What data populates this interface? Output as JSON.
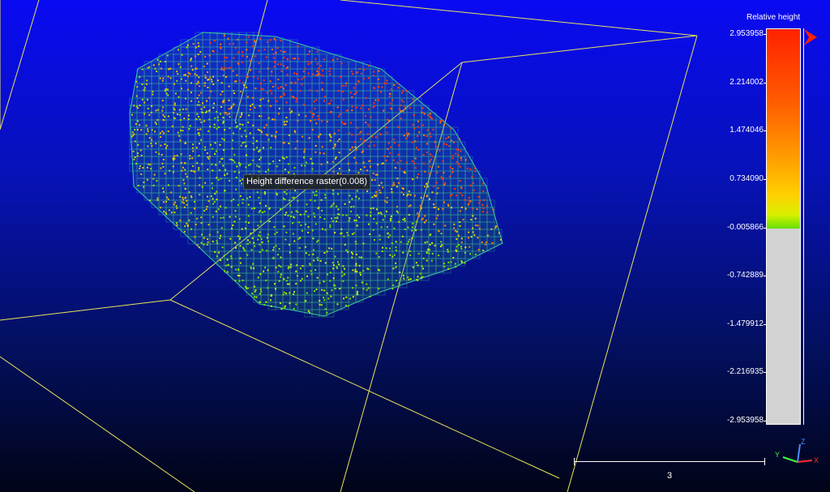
{
  "viewer": {
    "object_label": "Height difference raster(0.008)",
    "background_top": "#0a0af2",
    "background_bottom": "#010417",
    "bbox_color": "#e6e65a"
  },
  "legend": {
    "title": "Relative height",
    "ticks": [
      "2.953958",
      "2.214002",
      "1.474046",
      "0.734090",
      "-0.005866",
      "-0.742889",
      "-1.479912",
      "-2.216935",
      "-2.953958"
    ],
    "colors": {
      "high": "#ff2200",
      "mid_high": "#ff9a00",
      "mid": "#d8f000",
      "zero": "#66e000",
      "below": "#d2d2d2"
    }
  },
  "scale_bar": {
    "label": "3"
  },
  "axes": {
    "x": "X",
    "y": "Y",
    "z": "Z",
    "x_color": "#ff3030",
    "y_color": "#40ff40",
    "z_color": "#4a8cff"
  }
}
